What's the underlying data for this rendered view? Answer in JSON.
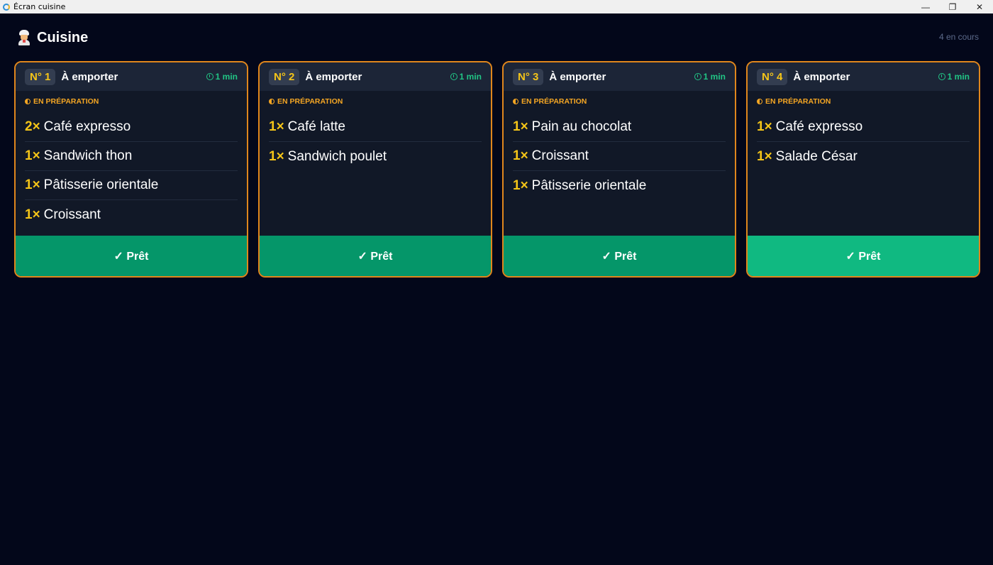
{
  "window": {
    "title": "Écran cuisine"
  },
  "header": {
    "title": "Cuisine",
    "order_count": "4 en cours"
  },
  "orders": [
    {
      "number": "N° 1",
      "type": "À emporter",
      "elapsed": "1 min",
      "status": "EN PRÉPARATION",
      "items": [
        {
          "qty": "2×",
          "name": "Café expresso"
        },
        {
          "qty": "1×",
          "name": "Sandwich thon"
        },
        {
          "qty": "1×",
          "name": "Pâtisserie orientale"
        },
        {
          "qty": "1×",
          "name": "Croissant"
        }
      ],
      "ready_label": "✓ Prêt"
    },
    {
      "number": "N° 2",
      "type": "À emporter",
      "elapsed": "1 min",
      "status": "EN PRÉPARATION",
      "items": [
        {
          "qty": "1×",
          "name": "Café latte"
        },
        {
          "qty": "1×",
          "name": "Sandwich poulet"
        }
      ],
      "ready_label": "✓ Prêt"
    },
    {
      "number": "N° 3",
      "type": "À emporter",
      "elapsed": "1 min",
      "status": "EN PRÉPARATION",
      "items": [
        {
          "qty": "1×",
          "name": "Pain au chocolat"
        },
        {
          "qty": "1×",
          "name": "Croissant"
        },
        {
          "qty": "1×",
          "name": "Pâtisserie orientale"
        }
      ],
      "ready_label": "✓ Prêt"
    },
    {
      "number": "N° 4",
      "type": "À emporter",
      "elapsed": "1 min",
      "status": "EN PRÉPARATION",
      "items": [
        {
          "qty": "1×",
          "name": "Café expresso"
        },
        {
          "qty": "1×",
          "name": "Salade César"
        }
      ],
      "ready_label": "✓ Prêt"
    }
  ],
  "colors": {
    "background": "#03071a",
    "accent": "#e0861c",
    "ready": "#059669",
    "ready_hover": "#10b981",
    "quantity": "#f5c518",
    "status": "#f5a623",
    "timer": "#21c585"
  }
}
